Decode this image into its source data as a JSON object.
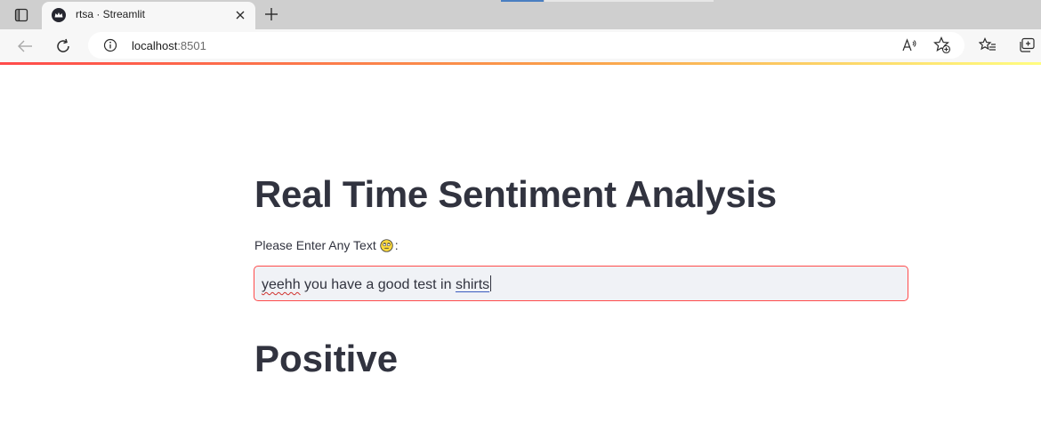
{
  "browser": {
    "tab_title": "rtsa · Streamlit",
    "address_host": "localhost",
    "address_port": ":8501",
    "accent_color": "#ff4b4b"
  },
  "icons": {
    "sidebar": "tab-actions-icon",
    "favicon": "streamlit-crown-icon",
    "close": "close-icon",
    "new_tab": "plus-icon",
    "back": "back-arrow-icon",
    "refresh": "refresh-icon",
    "info": "info-icon",
    "read_aloud": "read-aloud-icon",
    "add_favorite": "add-favorite-icon",
    "favorites": "favorites-icon",
    "collections": "collections-icon"
  },
  "page": {
    "title": "Real Time Sentiment Analysis",
    "input_label": "Please Enter Any Text",
    "input_label_suffix": ":",
    "input_value_misspelled": "yeehh",
    "input_value_middle": " you have a good test in ",
    "input_value_link": "shirts",
    "result": "Positive"
  }
}
